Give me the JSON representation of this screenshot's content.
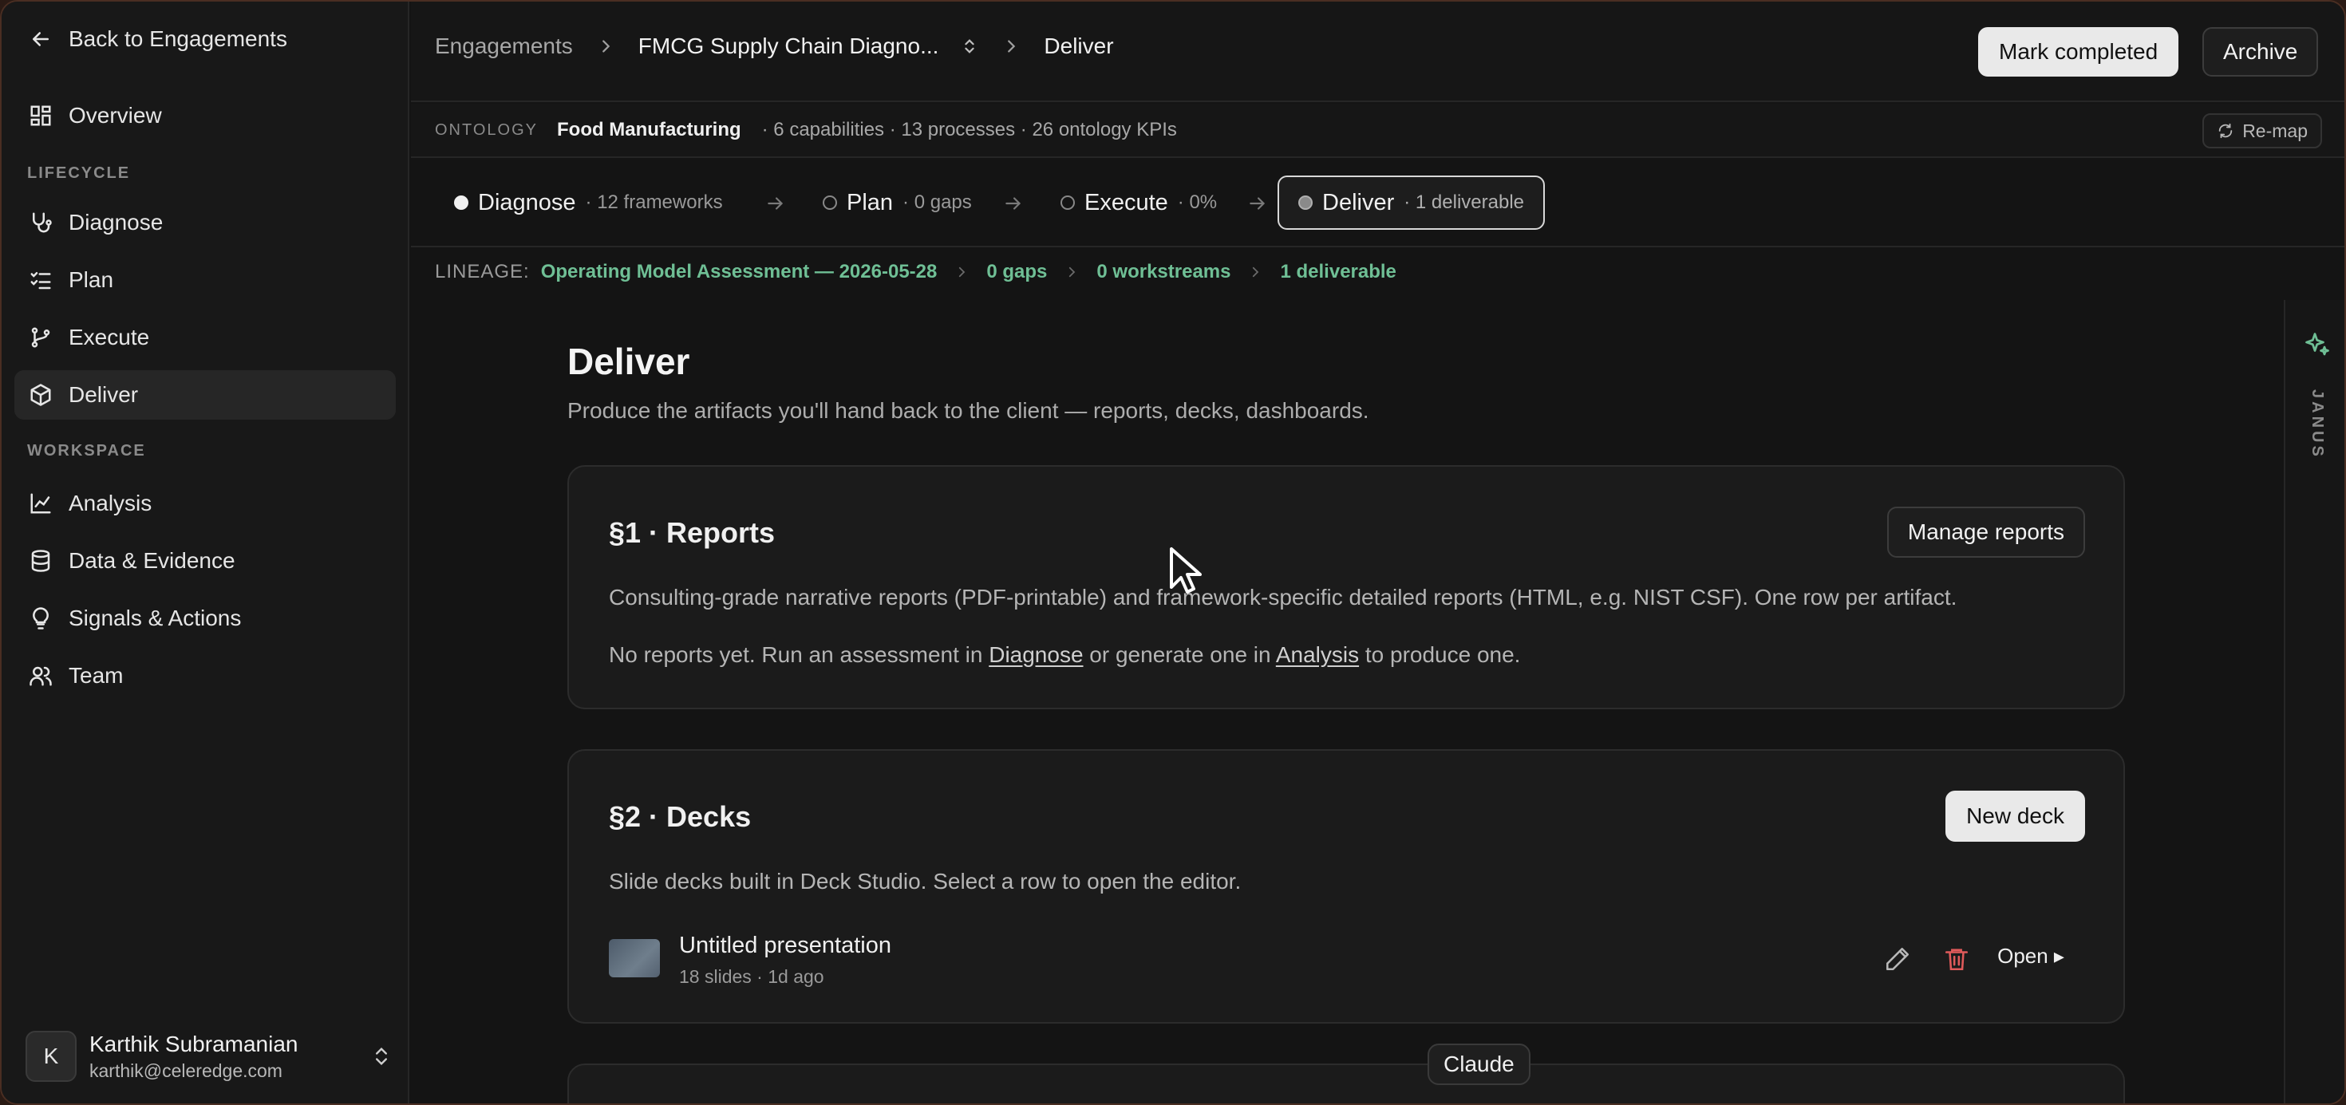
{
  "sidebar": {
    "back_label": "Back to Engagements",
    "overview_label": "Overview",
    "lifecycle_section": "LIFECYCLE",
    "lifecycle_items": [
      {
        "label": "Diagnose"
      },
      {
        "label": "Plan"
      },
      {
        "label": "Execute"
      },
      {
        "label": "Deliver"
      }
    ],
    "workspace_section": "WORKSPACE",
    "workspace_items": [
      {
        "label": "Analysis"
      },
      {
        "label": "Data & Evidence"
      },
      {
        "label": "Signals & Actions"
      },
      {
        "label": "Team"
      }
    ],
    "active_item": "Deliver",
    "user": {
      "initial": "K",
      "name": "Karthik Subramanian",
      "email": "karthik@celeredge.com"
    }
  },
  "header": {
    "breadcrumbs": [
      "Engagements",
      "FMCG Supply Chain Diagno...",
      "Deliver"
    ],
    "mark_completed_label": "Mark completed",
    "archive_label": "Archive"
  },
  "ontology": {
    "label": "ONTOLOGY",
    "name": "Food Manufacturing",
    "stats": "· 6 capabilities · 13 processes · 26 ontology KPIs",
    "remap_label": "Re-map"
  },
  "lifecycle": {
    "stages": [
      {
        "name": "Diagnose",
        "meta": "· 12 frameworks"
      },
      {
        "name": "Plan",
        "meta": "· 0 gaps"
      },
      {
        "name": "Execute",
        "meta": "· 0%"
      },
      {
        "name": "Deliver",
        "meta": "· 1 deliverable"
      }
    ],
    "active_stage": "Deliver"
  },
  "lineage": {
    "label": "LINEAGE:",
    "items": [
      "Operating Model Assessment — 2026-05-28",
      "0 gaps",
      "0 workstreams",
      "1 deliverable"
    ]
  },
  "page": {
    "title": "Deliver",
    "subtitle": "Produce the artifacts you'll hand back to the client — reports, decks, dashboards."
  },
  "reports": {
    "title": "§1 · Reports",
    "button_label": "Manage reports",
    "description": "Consulting-grade narrative reports (PDF-printable) and framework-specific detailed reports (HTML, e.g. NIST CSF). One row per artifact.",
    "empty_prefix": "No reports yet. Run an assessment in ",
    "empty_link_diagnose": "Diagnose",
    "empty_middle": " or generate one in ",
    "empty_link_analysis": "Analysis",
    "empty_suffix": " to produce one."
  },
  "decks": {
    "title": "§2 · Decks",
    "button_label": "New deck",
    "description": "Slide decks built in Deck Studio. Select a row to open the editor.",
    "rows": [
      {
        "name": "Untitled presentation",
        "meta": "18 slides · 1d ago",
        "open_label": "Open ▸"
      }
    ]
  },
  "rail": {
    "label": "JANUS"
  },
  "tooltip": {
    "label": "Claude"
  },
  "colors": {
    "accent_green": "#6fbf95",
    "danger_red": "#e05a5a",
    "background": "#141414"
  }
}
